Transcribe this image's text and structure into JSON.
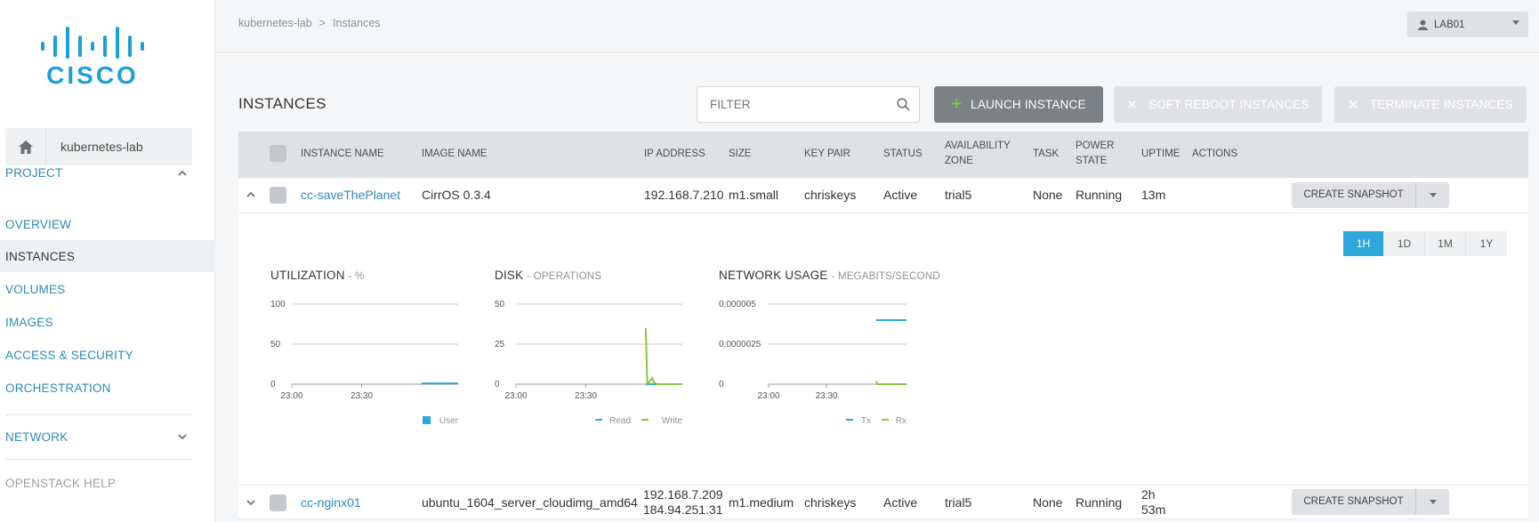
{
  "sidebar": {
    "project_name": "kubernetes-lab",
    "project_section": "PROJECT",
    "items": [
      {
        "label": "OVERVIEW"
      },
      {
        "label": "INSTANCES"
      },
      {
        "label": "VOLUMES"
      },
      {
        "label": "IMAGES"
      },
      {
        "label": "ACCESS & SECURITY"
      },
      {
        "label": "ORCHESTRATION"
      }
    ],
    "network_section": "NETWORK",
    "help": "OPENSTACK HELP"
  },
  "topbar": {
    "breadcrumb": [
      "kubernetes-lab",
      "Instances"
    ],
    "user": "LAB01"
  },
  "page": {
    "title": "INSTANCES",
    "filter_placeholder": "FILTER",
    "launch_label": "LAUNCH INSTANCE",
    "reboot_label": "SOFT REBOOT INSTANCES",
    "terminate_label": "TERMINATE INSTANCES"
  },
  "table": {
    "headers": {
      "name": "INSTANCE NAME",
      "image": "IMAGE NAME",
      "ip": "IP ADDRESS",
      "size": "SIZE",
      "keypair": "KEY PAIR",
      "status": "STATUS",
      "zone_1": "AVAILABILITY",
      "zone_2": "ZONE",
      "task": "TASK",
      "power_1": "POWER",
      "power_2": "STATE",
      "uptime": "UPTIME",
      "actions": "ACTIONS"
    },
    "rows": [
      {
        "name": "cc-saveThePlanet",
        "image": "CirrOS 0.3.4",
        "ip1": "192.168.7.210",
        "ip2": "",
        "size": "m1.small",
        "keypair": "chriskeys",
        "status": "Active",
        "zone": "trial5",
        "task": "None",
        "power": "Running",
        "uptime1": "13m",
        "uptime2": "",
        "action": "CREATE SNAPSHOT"
      },
      {
        "name": "cc-nginx01",
        "image": "ubuntu_1604_server_cloudimg_amd64",
        "ip1": "192.168.7.209",
        "ip2": "184.94.251.31",
        "size": "m1.medium",
        "keypair": "chriskeys",
        "status": "Active",
        "zone": "trial5",
        "task": "None",
        "power": "Running",
        "uptime1": "2h",
        "uptime2": "53m",
        "action": "CREATE SNAPSHOT"
      }
    ]
  },
  "details": {
    "ranges": [
      "1H",
      "1D",
      "1M",
      "1Y"
    ],
    "active_range": "1H",
    "colors": {
      "blue": "#2ea8dc",
      "green": "#8cc63f"
    }
  },
  "chart_data": [
    {
      "type": "line",
      "title": "UTILIZATION",
      "subtitle": "- %",
      "x_ticks": [
        "23:00",
        "23:30"
      ],
      "y_ticks": [
        "100",
        "50",
        "0"
      ],
      "ylim": [
        0,
        100
      ],
      "series": [
        {
          "name": "User",
          "color": "#2ea8dc",
          "x": [
            0.78,
            1.0
          ],
          "values": [
            1,
            1
          ]
        }
      ]
    },
    {
      "type": "line",
      "title": "DISK",
      "subtitle": "- OPERATIONS",
      "x_ticks": [
        "23:00",
        "23:30"
      ],
      "y_ticks": [
        "50",
        "25",
        "0"
      ],
      "ylim": [
        0,
        50
      ],
      "series": [
        {
          "name": "Read",
          "color": "#2ea8dc",
          "x": [
            0.78,
            1.0
          ],
          "values": [
            0,
            0
          ]
        },
        {
          "name": "Write",
          "color": "#8cc63f",
          "x": [
            0.78,
            0.79,
            0.82,
            0.83,
            0.85,
            1.0
          ],
          "values": [
            35,
            0,
            4,
            1,
            0,
            0
          ]
        }
      ]
    },
    {
      "type": "line",
      "title": "NETWORK USAGE",
      "subtitle": "- MEGABITS/SECOND",
      "x_ticks": [
        "23:00",
        "23:30"
      ],
      "y_ticks": [
        "0.000005",
        "0.0000025",
        "0"
      ],
      "ylim": [
        0,
        5e-06
      ],
      "series": [
        {
          "name": "Tx",
          "color": "#2ea8dc",
          "x": [
            0.78,
            1.0
          ],
          "values": [
            4e-06,
            4e-06
          ]
        },
        {
          "name": "Rx",
          "color": "#8cc63f",
          "x": [
            0.78,
            0.79,
            1.0
          ],
          "values": [
            2e-07,
            0,
            0
          ]
        }
      ]
    }
  ]
}
